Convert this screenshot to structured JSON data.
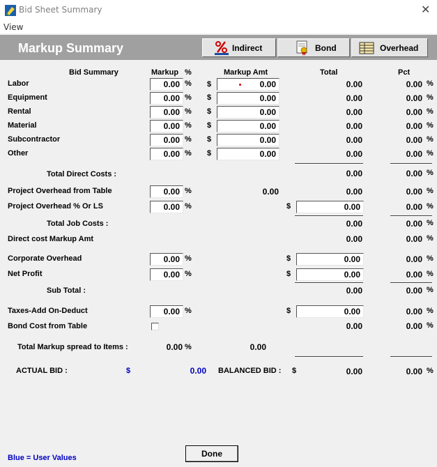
{
  "window": {
    "title": "Bid Sheet Summary",
    "menu_view": "View"
  },
  "header": {
    "title": "Markup Summary",
    "buttons": {
      "indirect": "Indirect",
      "bond": "Bond",
      "overhead": "Overhead"
    }
  },
  "columns": {
    "bid_summary": "Bid Summary",
    "markup": "Markup",
    "markup_pct_sym": "%",
    "markup_amt": "Markup Amt",
    "total": "Total",
    "pct": "Pct"
  },
  "symbols": {
    "pct": "%",
    "dollar": "$"
  },
  "rows": [
    {
      "label": "Labor",
      "markup": "0.00",
      "amt": "0.00",
      "total": "0.00",
      "pct": "0.00"
    },
    {
      "label": "Equipment",
      "markup": "0.00",
      "amt": "0.00",
      "total": "0.00",
      "pct": "0.00"
    },
    {
      "label": "Rental",
      "markup": "0.00",
      "amt": "0.00",
      "total": "0.00",
      "pct": "0.00"
    },
    {
      "label": "Material",
      "markup": "0.00",
      "amt": "0.00",
      "total": "0.00",
      "pct": "0.00"
    },
    {
      "label": "Subcontractor",
      "markup": "0.00",
      "amt": "0.00",
      "total": "0.00",
      "pct": "0.00"
    },
    {
      "label": "Other",
      "markup": "0.00",
      "amt": "0.00",
      "total": "0.00",
      "pct": "0.00"
    }
  ],
  "total_direct": {
    "label": "Total Direct Costs :",
    "total": "0.00",
    "pct": "0.00"
  },
  "proj_oh_table": {
    "label": "Project Overhead from Table",
    "markup": "0.00",
    "amt": "0.00",
    "total": "0.00",
    "pct": "0.00"
  },
  "proj_oh_pct": {
    "label": "Project Overhead % Or LS",
    "markup": "0.00",
    "total": "0.00",
    "pct": "0.00"
  },
  "total_job": {
    "label": "Total Job Costs :",
    "total": "0.00",
    "pct": "0.00"
  },
  "direct_markup": {
    "label": "Direct cost Markup Amt",
    "total": "0.00",
    "pct": "0.00"
  },
  "corp_oh": {
    "label": "Corporate Overhead",
    "markup": "0.00",
    "total": "0.00",
    "pct": "0.00"
  },
  "net_profit": {
    "label": "Net Profit",
    "markup": "0.00",
    "total": "0.00",
    "pct": "0.00"
  },
  "sub_total": {
    "label": "Sub Total :",
    "total": "0.00",
    "pct": "0.00"
  },
  "taxes": {
    "label": "Taxes-Add On-Deduct",
    "markup": "0.00",
    "total": "0.00",
    "pct": "0.00"
  },
  "bond_cost": {
    "label": "Bond Cost from Table",
    "total": "0.00",
    "pct": "0.00"
  },
  "total_markup": {
    "label": "Total Markup spread to Items :",
    "pct": "0.00",
    "amt": "0.00"
  },
  "actual_bid": {
    "label": "ACTUAL BID :",
    "value": "0.00"
  },
  "balanced_bid": {
    "label": "BALANCED BID :",
    "value": "0.00",
    "pct": "0.00"
  },
  "legend": "Blue = User Values",
  "done": "Done",
  "colors": {
    "header_band": "#a0a0a0",
    "user_value_blue": "#0000c0"
  }
}
